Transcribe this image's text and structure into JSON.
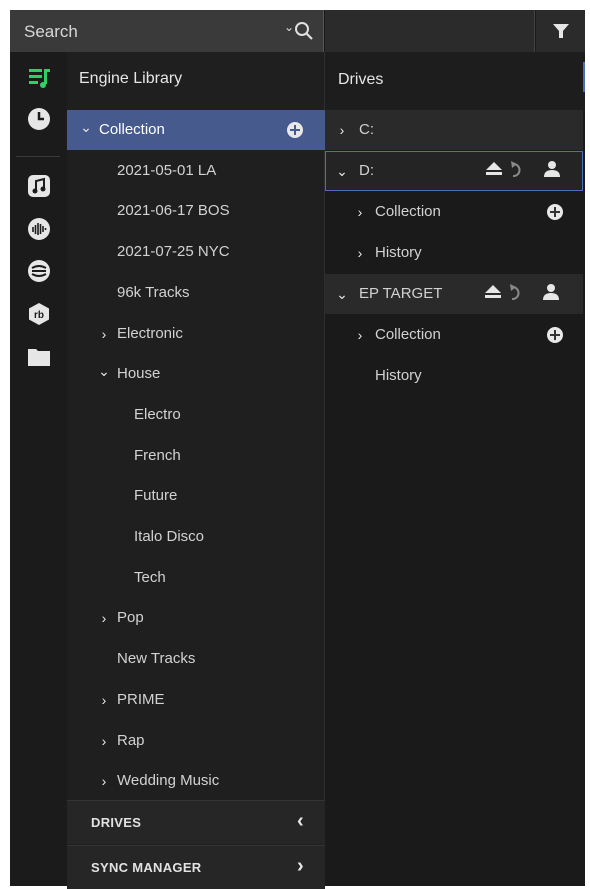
{
  "search": {
    "label": "Search"
  },
  "library": {
    "title": "Engine Library",
    "items": [
      {
        "label": "Collection",
        "chevron": "down",
        "level": 0,
        "selected": true,
        "add": true
      },
      {
        "label": "2021-05-01 LA",
        "chevron": "",
        "level": 1
      },
      {
        "label": "2021-06-17 BOS",
        "chevron": "",
        "level": 1
      },
      {
        "label": "2021-07-25 NYC",
        "chevron": "",
        "level": 1
      },
      {
        "label": "96k Tracks",
        "chevron": "",
        "level": 1
      },
      {
        "label": "Electronic",
        "chevron": "right",
        "level": 1
      },
      {
        "label": "House",
        "chevron": "down",
        "level": 1
      },
      {
        "label": "Electro",
        "chevron": "",
        "level": 2
      },
      {
        "label": "French",
        "chevron": "",
        "level": 2
      },
      {
        "label": "Future",
        "chevron": "",
        "level": 2
      },
      {
        "label": "Italo Disco",
        "chevron": "",
        "level": 2
      },
      {
        "label": "Tech",
        "chevron": "",
        "level": 2
      },
      {
        "label": "Pop",
        "chevron": "right",
        "level": 1
      },
      {
        "label": "New Tracks",
        "chevron": "",
        "level": 1
      },
      {
        "label": "PRIME",
        "chevron": "right",
        "level": 1
      },
      {
        "label": "Rap",
        "chevron": "right",
        "level": 1
      },
      {
        "label": "Wedding Music",
        "chevron": "right",
        "level": 1
      }
    ],
    "drives_bar": "DRIVES",
    "sync_bar": "SYNC MANAGER"
  },
  "drives": {
    "title": "Drives",
    "c_label": "C:",
    "d_label": "D:",
    "d_collection": "Collection",
    "d_history": "History",
    "ep_label": "EP TARGET",
    "ep_collection": "Collection",
    "ep_history": "History"
  },
  "colors": {
    "accent": "#465a8e",
    "green": "#2ed06a",
    "outline": "#4a6fb8"
  },
  "icons": {
    "rail": [
      "playlist-icon",
      "history-clock-icon",
      "music-note-icon",
      "soundcloud-icon",
      "tidal-icon",
      "rekordbox-icon",
      "folder-icon"
    ]
  }
}
